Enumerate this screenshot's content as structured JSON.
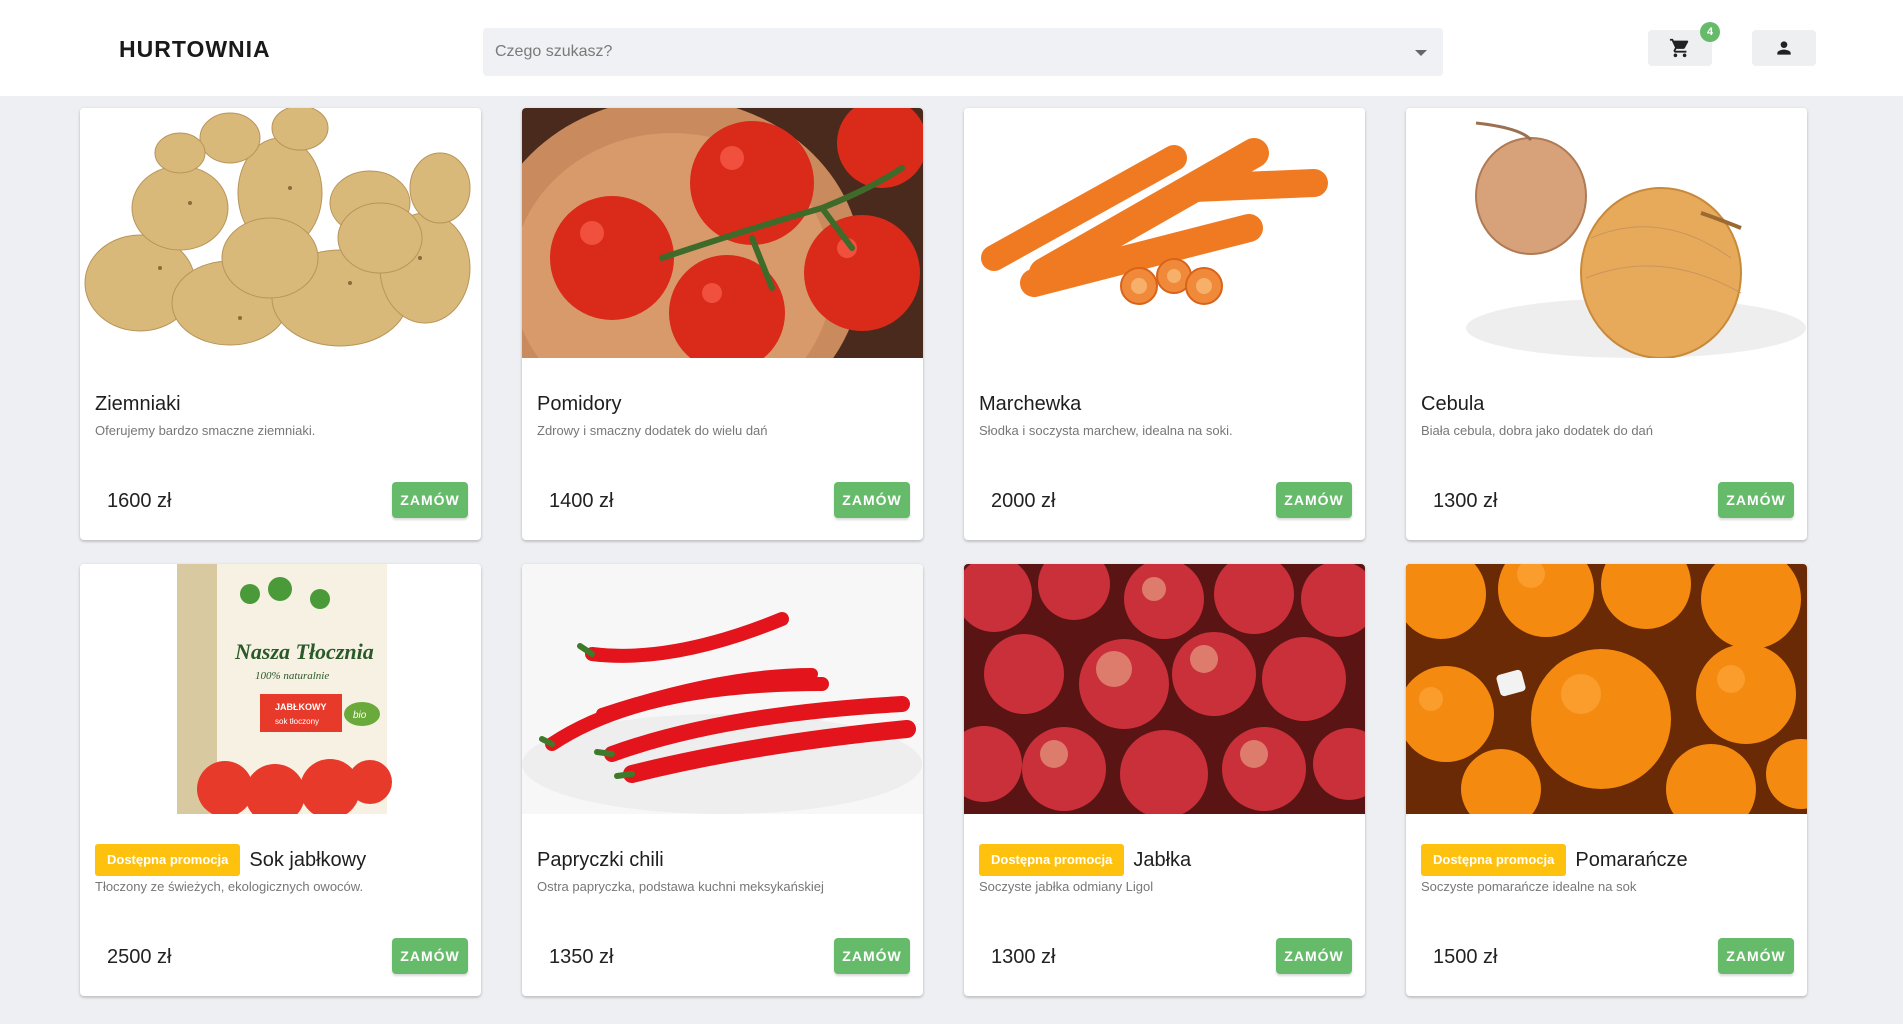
{
  "header": {
    "brand": "HURTOWNIA",
    "search_placeholder": "Czego szukasz?",
    "cart_count": "4",
    "cart_icon": "shopping-cart-icon",
    "user_icon": "person-icon"
  },
  "colors": {
    "accent_green": "#66bb6a",
    "promo_yellow": "#fdc10e",
    "background": "#eeeff3"
  },
  "products": [
    {
      "title": "Ziemniaki",
      "desc": "Oferujemy bardzo smaczne ziemniaki.",
      "price": "1600 zł",
      "order": "ZAMÓW",
      "promo": "",
      "image": "potatoes"
    },
    {
      "title": "Pomidory",
      "desc": "Zdrowy i smaczny dodatek do wielu dań",
      "price": "1400 zł",
      "order": "ZAMÓW",
      "promo": "",
      "image": "tomatoes"
    },
    {
      "title": "Marchewka",
      "desc": "Słodka i soczysta marchew, idealna na soki.",
      "price": "2000 zł",
      "order": "ZAMÓW",
      "promo": "",
      "image": "carrots"
    },
    {
      "title": "Cebula",
      "desc": "Biała cebula, dobra jako dodatek do dań",
      "price": "1300 zł",
      "order": "ZAMÓW",
      "promo": "",
      "image": "onions"
    },
    {
      "title": "Sok jabłkowy",
      "desc": "Tłoczony ze świeżych, ekologicznych owoców.",
      "price": "2500 zł",
      "order": "ZAMÓW",
      "promo": "Dostępna promocja",
      "image": "apple-juice",
      "image_text": [
        "Nasza Tłocznia",
        "100% naturalnie",
        "JABŁKOWY",
        "sok tłoczony",
        "bio"
      ]
    },
    {
      "title": "Papryczki chili",
      "desc": "Ostra papryczka, podstawa kuchni meksykańskiej",
      "price": "1350 zł",
      "order": "ZAMÓW",
      "promo": "",
      "image": "chili"
    },
    {
      "title": "Jabłka",
      "desc": "Soczyste jabłka odmiany Ligol",
      "price": "1300 zł",
      "order": "ZAMÓW",
      "promo": "Dostępna promocja",
      "image": "apples"
    },
    {
      "title": "Pomarańcze",
      "desc": "Soczyste pomarańcze idealne na sok",
      "price": "1500 zł",
      "order": "ZAMÓW",
      "promo": "Dostępna promocja",
      "image": "oranges"
    }
  ]
}
